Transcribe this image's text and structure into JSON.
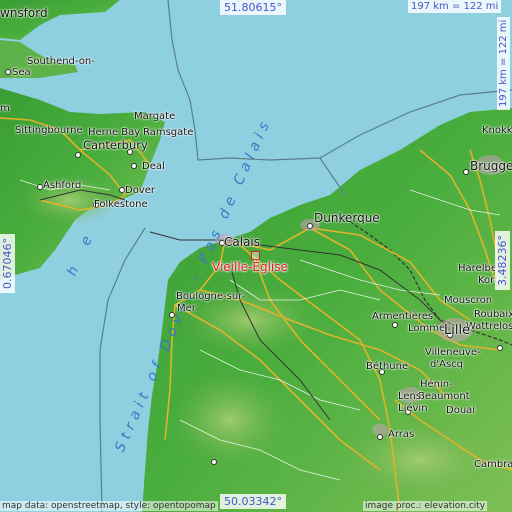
{
  "coords": {
    "top": "51.80615°",
    "bottom": "50.03342°",
    "left": "0.67046°",
    "right": "3.48236°"
  },
  "scale": {
    "top": "197 km = 122 mi",
    "right": "197 km = 122 mi"
  },
  "marker": {
    "label": "Vieille-Église",
    "color": "#e02020"
  },
  "sea_labels": {
    "strait": "Strait of Dover - Pas de Calais",
    "left_fragment": "h e"
  },
  "places": {
    "wnsford": "wnsford",
    "southend": "Southend-on-",
    "sea": "Sea",
    "margate": "Margate",
    "sittingbourne": "Sittingbourne",
    "herne_bay": "Herne Bay",
    "ramsgate": "Ramsgate",
    "canterbury": "Canterbury",
    "deal": "Deal",
    "ashford": "Ashford",
    "dover": "Dover",
    "folkestone": "Folkestone",
    "m": "m",
    "knokke": "Knokke",
    "brugge": "Brugge",
    "dunkerque": "Dunkerque",
    "calais": "Calais",
    "harelbek": "Harelbek",
    "korti": "Korti",
    "mouscron": "Mouscron",
    "roubaix": "Roubaix",
    "wattrelos": "Wattrelos",
    "boulogne": "Boulogne-sur-",
    "mer": "Mer",
    "armentieres": "Armentières",
    "lomme": "Lomme",
    "lille": "Lille",
    "villeneuve": "Villeneuve-",
    "dascq": "d'Ascq",
    "bethune": "Béthune",
    "henin": "Hénin-",
    "beaumont": "Beaumont",
    "lens": "Lens",
    "lievin": "Liévin",
    "douai": "Douai",
    "arras": "Arras",
    "cambrai": "Cambrai"
  },
  "credits": {
    "left": "map data: openstreetmap, style: opentopomap",
    "right": "image proc.: elevation.city"
  },
  "colors": {
    "sea": "#8fd0e0",
    "land_low": "#3fa23a",
    "land_high": "#86c25e",
    "road": "#e0b32a"
  }
}
